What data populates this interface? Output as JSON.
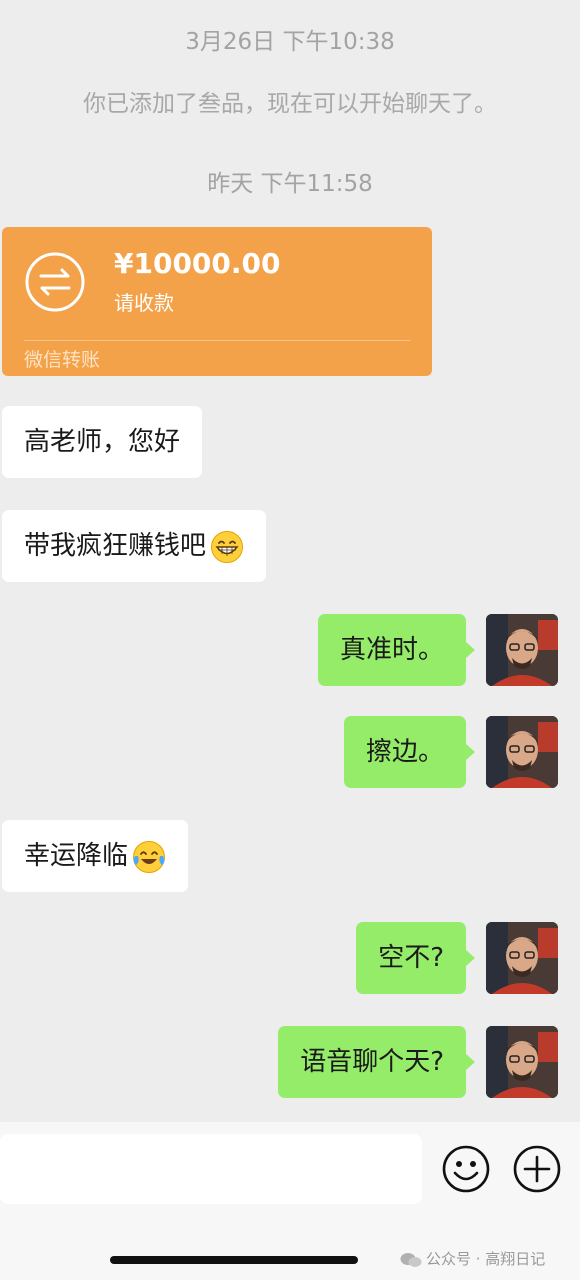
{
  "timestamps": [
    "3月26日 下午10:38",
    "昨天 下午11:58"
  ],
  "system_message": "你已添加了叁品，现在可以开始聊天了。",
  "transfer": {
    "amount": "¥10000.00",
    "status": "请收款",
    "footer": "微信转账",
    "icon": "transfer-arrows-icon",
    "color": "#f4a24a"
  },
  "messages": [
    {
      "side": "left",
      "text": "高老师，您好",
      "emoji": ""
    },
    {
      "side": "left",
      "text": "带我疯狂赚钱吧",
      "emoji": "grinning-face-icon"
    },
    {
      "side": "right",
      "text": "真准时。"
    },
    {
      "side": "right",
      "text": "擦边。"
    },
    {
      "side": "left",
      "text": "幸运降临",
      "emoji": "tears-of-joy-icon"
    },
    {
      "side": "right",
      "text": "空不?"
    },
    {
      "side": "right",
      "text": "语音聊个天?"
    }
  ],
  "input_bar": {
    "emoji_button_icon": "emoji-smile-icon",
    "plus_button_icon": "plus-circle-icon"
  },
  "watermark": "公众号 · 高翔日记",
  "colors": {
    "background": "#ededed",
    "sent_bubble": "#95ec69",
    "received_bubble": "#ffffff"
  }
}
